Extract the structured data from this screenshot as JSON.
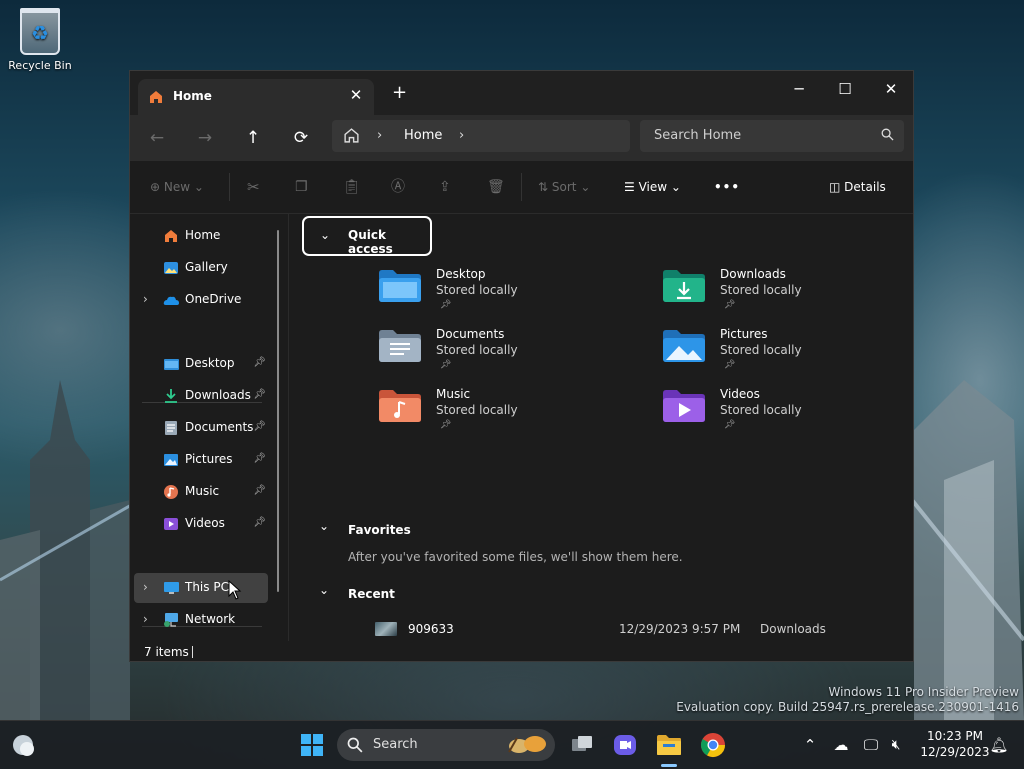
{
  "desktop": {
    "recycle_bin_label": "Recycle Bin",
    "watermark_line1": "Windows 11 Pro Insider Preview",
    "watermark_line2": "Evaluation copy. Build 25947.rs_prerelease.230901-1416"
  },
  "explorer": {
    "tab": {
      "label": "Home",
      "icon": "home-icon"
    },
    "window_controls": {
      "minimize": "─",
      "maximize": "☐",
      "close": "✕"
    },
    "nav": {
      "back": "←",
      "forward": "→",
      "up": "↑",
      "refresh": "⟳",
      "breadcrumb": [
        "Home"
      ],
      "search_placeholder": "Search Home"
    },
    "toolbar": {
      "new_label": "New",
      "sort_label": "Sort",
      "view_label": "View",
      "more_label": "•••",
      "details_label": "Details"
    },
    "sidebar": {
      "top_items": [
        {
          "label": "Home",
          "icon": "home-icon"
        },
        {
          "label": "Gallery",
          "icon": "gallery-icon"
        },
        {
          "label": "OneDrive",
          "icon": "onedrive-icon"
        }
      ],
      "pinned_items": [
        {
          "label": "Desktop",
          "icon": "desktop-folder-icon"
        },
        {
          "label": "Downloads",
          "icon": "downloads-icon"
        },
        {
          "label": "Documents",
          "icon": "documents-icon"
        },
        {
          "label": "Pictures",
          "icon": "pictures-icon"
        },
        {
          "label": "Music",
          "icon": "music-icon"
        },
        {
          "label": "Videos",
          "icon": "videos-icon"
        }
      ],
      "bottom_items": [
        {
          "label": "This PC",
          "icon": "this-pc-icon"
        },
        {
          "label": "Network",
          "icon": "network-icon"
        }
      ]
    },
    "quick_access": {
      "header": "Quick access",
      "items": [
        {
          "name": "Desktop",
          "sub": "Stored locally",
          "color": "#2f8ed9"
        },
        {
          "name": "Downloads",
          "sub": "Stored locally",
          "color": "#1fa07c"
        },
        {
          "name": "Documents",
          "sub": "Stored locally",
          "color": "#8fa3b8"
        },
        {
          "name": "Pictures",
          "sub": "Stored locally",
          "color": "#2b8fe0"
        },
        {
          "name": "Music",
          "sub": "Stored locally",
          "color": "#e4744f"
        },
        {
          "name": "Videos",
          "sub": "Stored locally",
          "color": "#8a4fd8"
        }
      ]
    },
    "favorites": {
      "header": "Favorites",
      "empty_text": "After you've favorited some files, we'll show them here."
    },
    "recent": {
      "header": "Recent",
      "items": [
        {
          "name": "909633",
          "date": "12/29/2023 9:57 PM",
          "location": "Downloads"
        }
      ]
    },
    "status": {
      "item_count": "7 items"
    }
  },
  "taskbar": {
    "search_placeholder": "Search",
    "clock_time": "10:23 PM",
    "clock_date": "12/29/2023",
    "apps": [
      "start-icon",
      "search-icon",
      "task-view-icon",
      "teams-icon",
      "file-explorer-icon",
      "chrome-icon"
    ]
  }
}
